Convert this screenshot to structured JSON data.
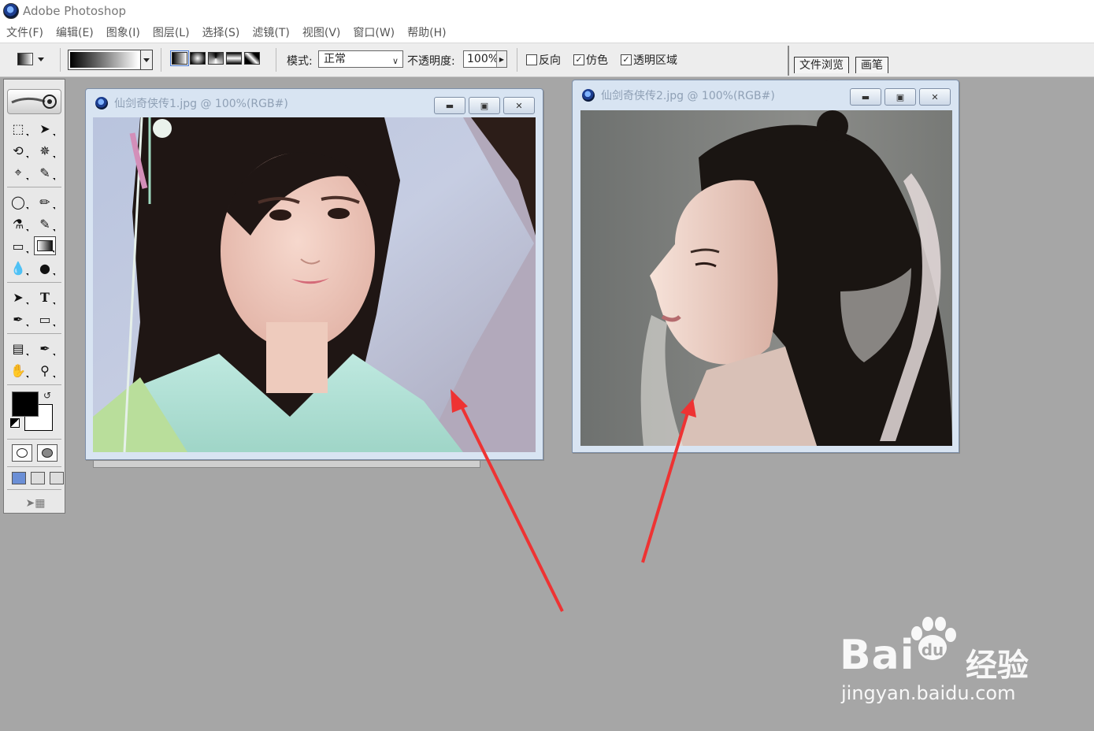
{
  "app": {
    "title": "Adobe Photoshop"
  },
  "menu": [
    "文件(F)",
    "编辑(E)",
    "图象(I)",
    "图层(L)",
    "选择(S)",
    "滤镜(T)",
    "视图(V)",
    "窗口(W)",
    "帮助(H)"
  ],
  "options_bar": {
    "mode_label": "模式:",
    "mode_value": "正常",
    "opacity_label": "不透明度:",
    "opacity_value": "100%",
    "reverse_label": "反向",
    "reverse_checked": false,
    "dither_label": "仿色",
    "dither_checked": true,
    "transparency_label": "透明区域",
    "transparency_checked": true
  },
  "palette_well": {
    "tabs": [
      "文件浏览",
      "画笔"
    ]
  },
  "toolbox": {
    "tools": [
      "marquee",
      "move",
      "lasso",
      "magic-wand",
      "crop",
      "slice",
      "healing",
      "brush",
      "stamp",
      "history-brush",
      "eraser",
      "gradient",
      "blur",
      "dodge",
      "path-select",
      "type",
      "pen",
      "shape",
      "notes",
      "eyedropper",
      "hand",
      "zoom"
    ],
    "active_tool": "gradient",
    "foreground_color": "#000000",
    "background_color": "#ffffff"
  },
  "documents": [
    {
      "title": "仙剑奇侠传1.jpg @ 100%(RGB#)"
    },
    {
      "title": "仙剑奇侠传2.jpg @ 100%(RGB#)"
    }
  ],
  "watermark": {
    "brand": "Bai",
    "brand_cn": "经验",
    "url": "jingyan.baidu.com"
  },
  "colors": {
    "workspace": "#a6a6a6",
    "arrow": "#ee3333",
    "window_frame": "#d8e4f2"
  }
}
